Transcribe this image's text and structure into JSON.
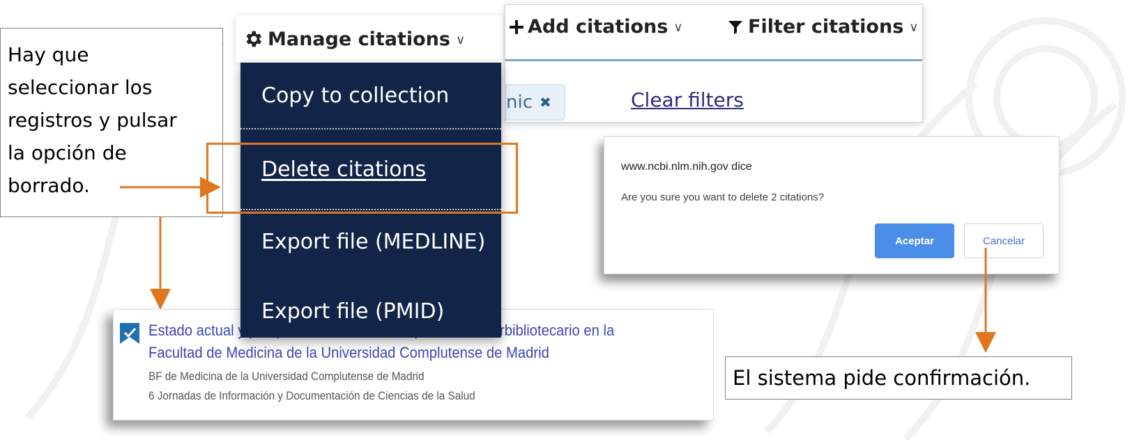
{
  "callouts": {
    "left_text": "Hay que\nseleccionar los\nregistros y pulsar\nla  opción de\nborrado.",
    "right_text": "El sistema pide confirmación."
  },
  "manage_menu": {
    "header_label": "Manage citations",
    "header_icon": "gear-icon",
    "items": [
      {
        "label": "Copy to collection"
      },
      {
        "label": "Delete citations",
        "highlighted": true
      },
      {
        "label": "Export file (MEDLINE)"
      },
      {
        "label": "Export file (PMID)"
      }
    ]
  },
  "toolbar": {
    "add_label": "Add citations",
    "add_icon": "plus-icon",
    "filter_label": "Filter citations",
    "filter_icon": "filter-icon",
    "chip_text": "nic",
    "clear_filters_label": "Clear filters"
  },
  "dialog": {
    "origin": "www.ncbi.nlm.nih.gov dice",
    "message": "Are you sure you want to delete 2 citations?",
    "accept_label": "Aceptar",
    "cancel_label": "Cancelar"
  },
  "result": {
    "title": "Estado actual y perspectivas de futuro del préstamo interbibliotecario en la Facultad de Medicina de la Universidad Complutense de Madrid",
    "meta_line1": "BF de Medicina de la Universidad Complutense de Madrid",
    "meta_line2": "6 Jornadas de Información y Documentación de Ciencias de la Salud",
    "icon": "bookmark-icon"
  },
  "colors": {
    "menu_bg": "#122447",
    "highlight_orange": "#e0761e",
    "accept_blue": "#4a8ee8",
    "link_blue": "#3b46b6"
  }
}
